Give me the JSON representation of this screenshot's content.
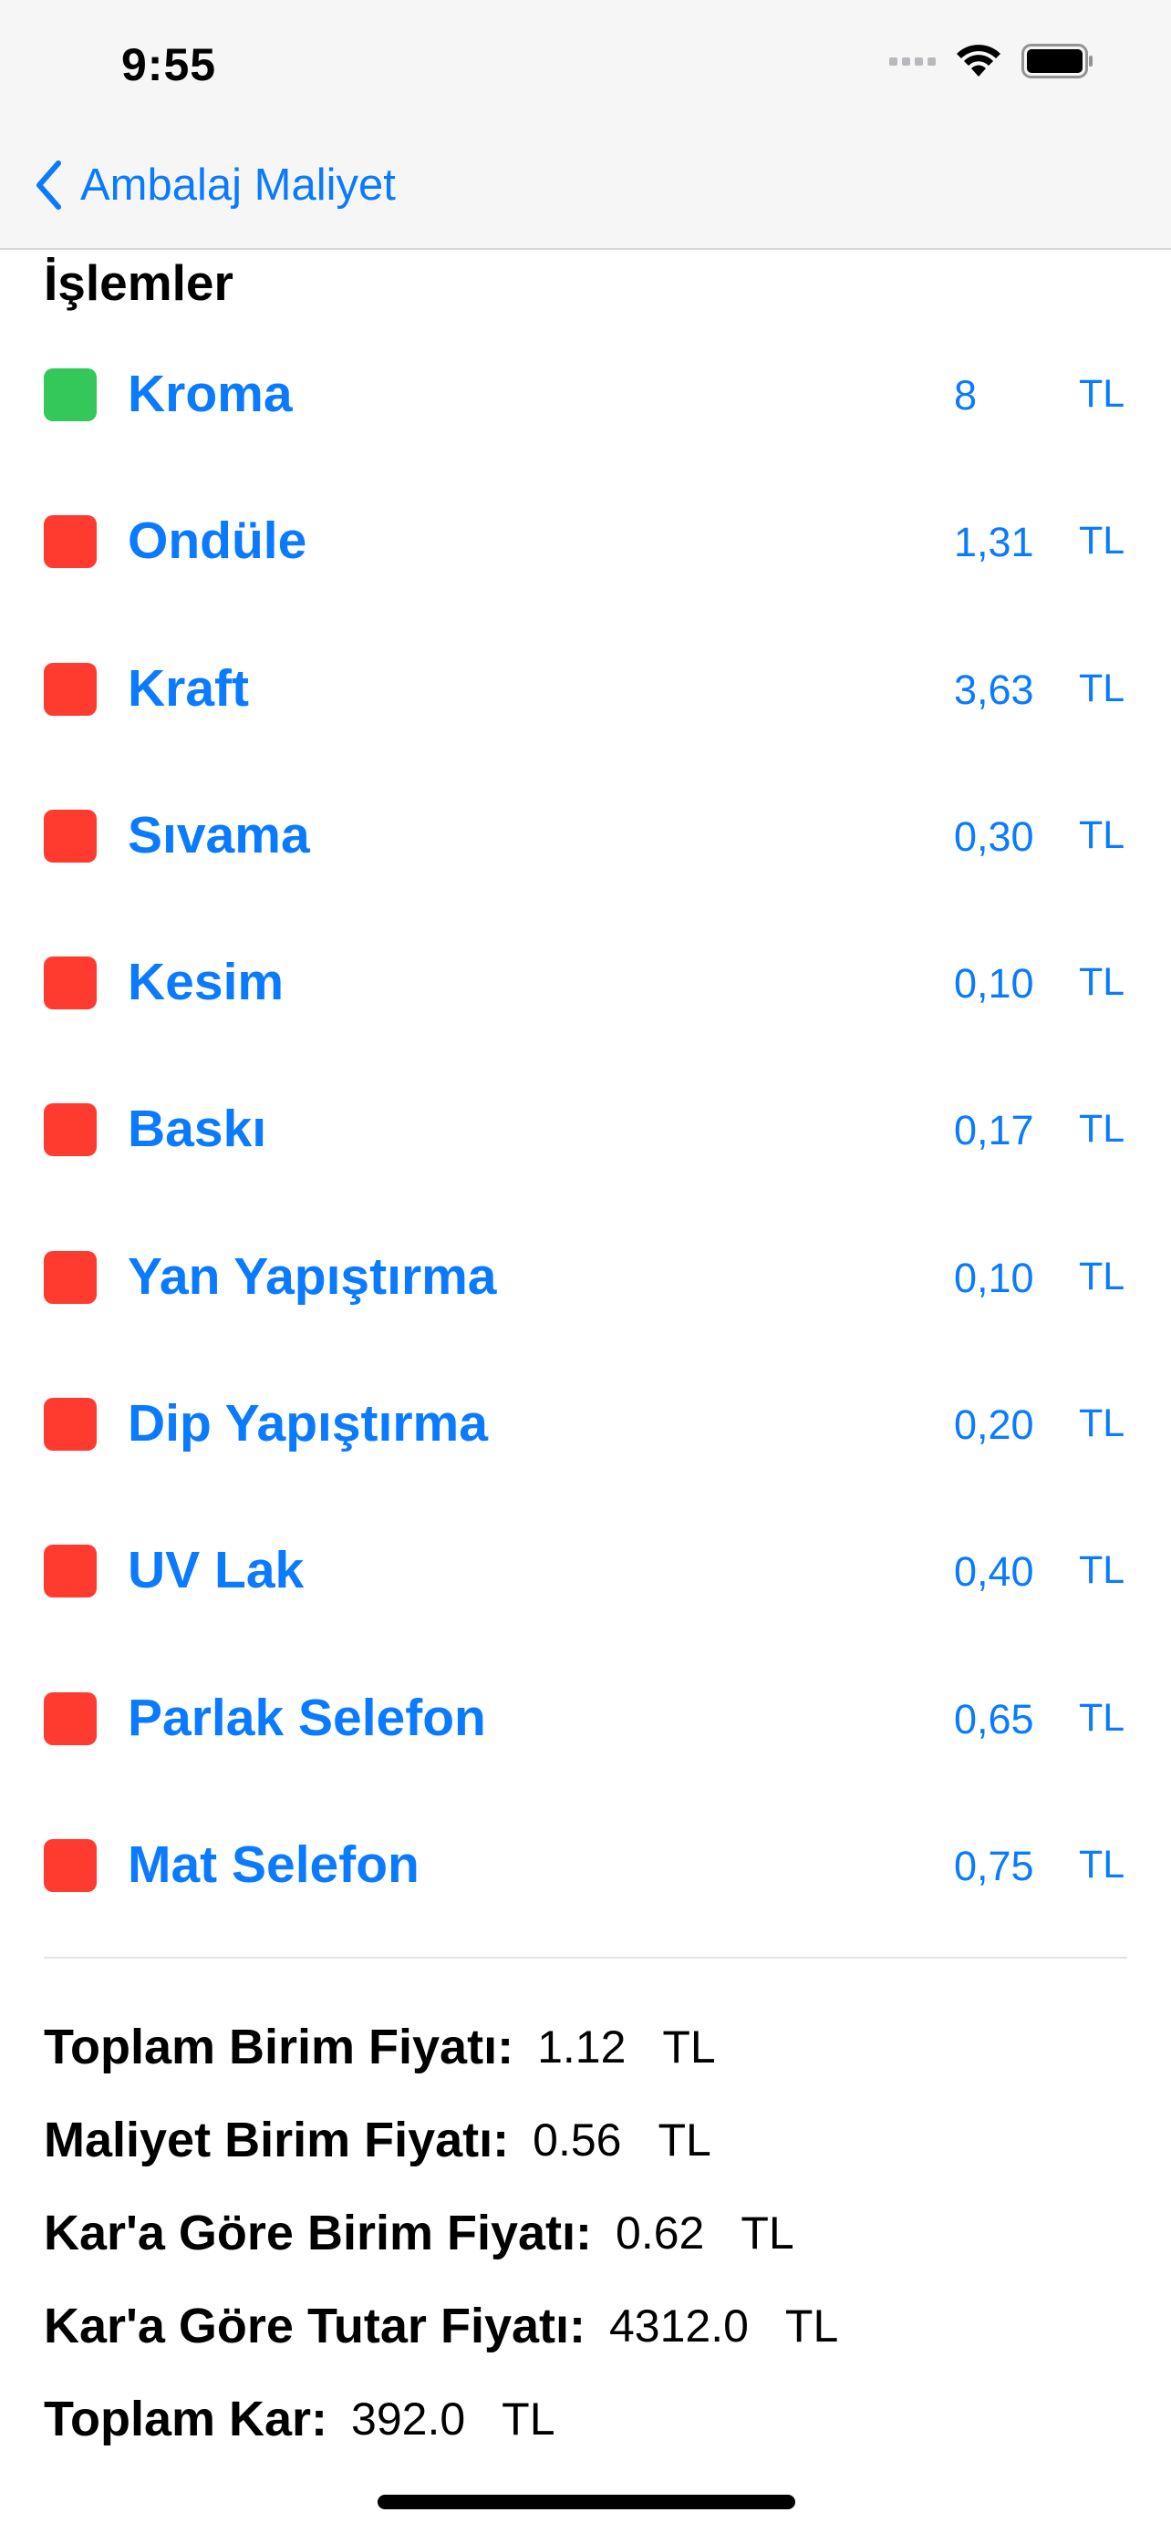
{
  "status": {
    "time": "9:55"
  },
  "nav": {
    "back_label": "Ambalaj Maliyet",
    "accent_color": "#0a7aff"
  },
  "section": {
    "title": "İşlemler"
  },
  "items": [
    {
      "label": "Kroma",
      "value": "8",
      "unit": "TL",
      "status": "green",
      "color": "#34c759"
    },
    {
      "label": "Ondüle",
      "value": "1,31",
      "unit": "TL",
      "status": "red",
      "color": "#ff3b30"
    },
    {
      "label": "Kraft",
      "value": "3,63",
      "unit": "TL",
      "status": "red",
      "color": "#ff3b30"
    },
    {
      "label": "Sıvama",
      "value": "0,30",
      "unit": "TL",
      "status": "red",
      "color": "#ff3b30"
    },
    {
      "label": "Kesim",
      "value": "0,10",
      "unit": "TL",
      "status": "red",
      "color": "#ff3b30"
    },
    {
      "label": "Baskı",
      "value": "0,17",
      "unit": "TL",
      "status": "red",
      "color": "#ff3b30"
    },
    {
      "label": "Yan Yapıştırma",
      "value": "0,10",
      "unit": "TL",
      "status": "red",
      "color": "#ff3b30"
    },
    {
      "label": "Dip Yapıştırma",
      "value": "0,20",
      "unit": "TL",
      "status": "red",
      "color": "#ff3b30"
    },
    {
      "label": "UV Lak",
      "value": "0,40",
      "unit": "TL",
      "status": "red",
      "color": "#ff3b30"
    },
    {
      "label": "Parlak Selefon",
      "value": "0,65",
      "unit": "TL",
      "status": "red",
      "color": "#ff3b30"
    },
    {
      "label": "Mat Selefon",
      "value": "0,75",
      "unit": "TL",
      "status": "red",
      "color": "#ff3b30"
    }
  ],
  "summary": [
    {
      "label": "Toplam Birim Fiyatı:",
      "value": "1.12",
      "unit": "TL"
    },
    {
      "label": "Maliyet Birim Fiyatı:",
      "value": "0.56",
      "unit": "TL"
    },
    {
      "label": "Kar'a Göre Birim Fiyatı:",
      "value": "0.62",
      "unit": "TL"
    },
    {
      "label": "Kar'a Göre Tutar Fiyatı:",
      "value": "4312.0",
      "unit": "TL"
    },
    {
      "label": "Toplam Kar:",
      "value": "392.0",
      "unit": "TL"
    }
  ]
}
